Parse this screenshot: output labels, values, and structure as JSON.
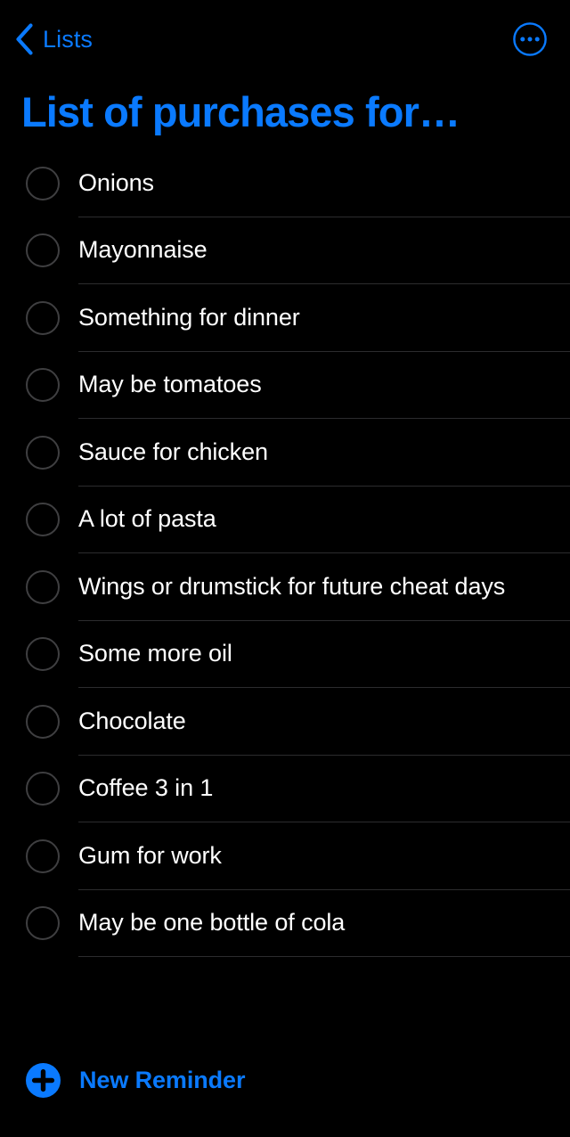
{
  "colors": {
    "background": "#000000",
    "accent": "#0a7aff",
    "text": "#ffffff",
    "separator": "#2c2c2e",
    "toggle_stroke": "#3f3f41"
  },
  "navbar": {
    "back_label": "Lists",
    "back_icon": "chevron-left-icon",
    "more_icon": "ellipsis-circle-icon"
  },
  "header": {
    "title": "List of purchases for…"
  },
  "list": {
    "items": [
      {
        "label": "Onions",
        "completed": false
      },
      {
        "label": "Mayonnaise",
        "completed": false
      },
      {
        "label": "Something for dinner",
        "completed": false
      },
      {
        "label": "May be tomatoes",
        "completed": false
      },
      {
        "label": "Sauce for chicken",
        "completed": false
      },
      {
        "label": "A lot of pasta",
        "completed": false
      },
      {
        "label": "Wings or drumstick for future cheat days",
        "completed": false
      },
      {
        "label": "Some more oil",
        "completed": false
      },
      {
        "label": "Chocolate",
        "completed": false
      },
      {
        "label": "Coffee 3 in 1",
        "completed": false
      },
      {
        "label": "Gum for work",
        "completed": false
      },
      {
        "label": "May be one bottle of cola",
        "completed": false
      }
    ]
  },
  "footer": {
    "new_reminder_label": "New Reminder",
    "new_reminder_icon": "plus-circle-icon"
  }
}
